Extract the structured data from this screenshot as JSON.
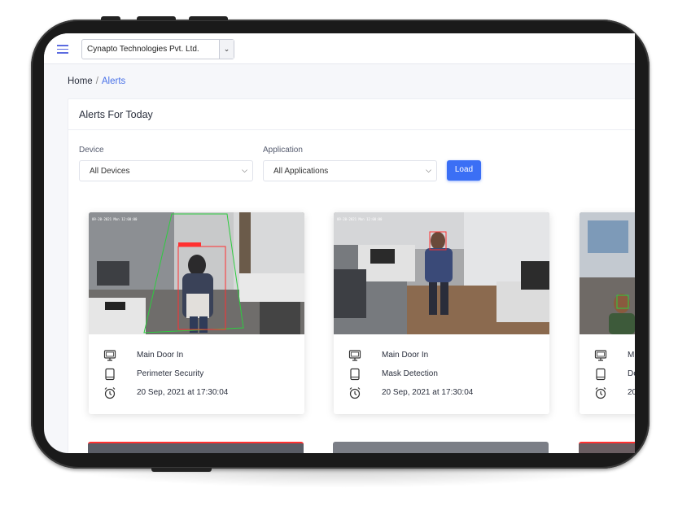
{
  "topbar": {
    "organization": "Cynapto Technologies Pvt. Ltd.",
    "menu_icon": "hamburger-icon",
    "caret_icon": "chevron-down-icon"
  },
  "breadcrumb": {
    "home": "Home",
    "separator": "/",
    "current": "Alerts"
  },
  "panel": {
    "title": "Alerts For Today"
  },
  "filters": {
    "device_label": "Device",
    "device_value": "All Devices",
    "application_label": "Application",
    "application_value": "All Applications",
    "load_label": "Load"
  },
  "alerts": [
    {
      "device": "Main Door In",
      "application": "Perimeter Security",
      "time": "20 Sep, 2021 at 17:30:04"
    },
    {
      "device": "Main Door In",
      "application": "Mask Detection",
      "time": "20 Sep, 2021 at 17:30:04"
    },
    {
      "device": "M",
      "application": "De",
      "time": "20"
    }
  ],
  "icons": {
    "device": "monitor-icon",
    "application": "tablet-icon",
    "time": "alarm-clock-icon"
  },
  "colors": {
    "accent": "#3b6ff5",
    "link": "#4a72e8",
    "hamburger": "#5b6be0"
  }
}
